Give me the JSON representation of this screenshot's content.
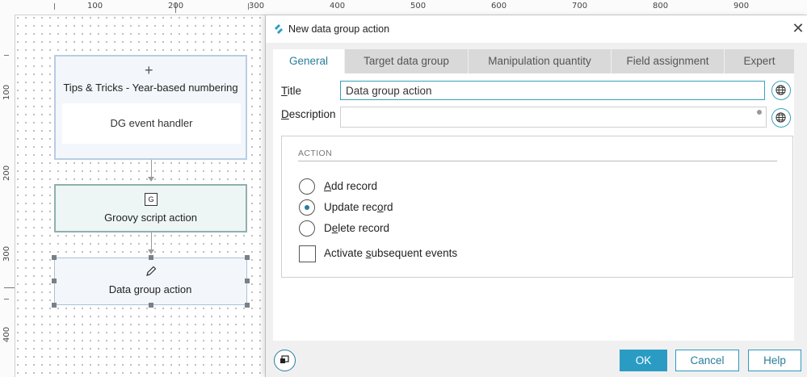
{
  "ruler": {
    "top_labels": [
      "100",
      "200",
      "300",
      "400",
      "500",
      "600",
      "700",
      "800",
      "900"
    ],
    "left_labels": [
      "100",
      "200",
      "300",
      "400"
    ]
  },
  "canvas": {
    "nodes": {
      "handler_title": "Tips & Tricks - Year-based numbering",
      "handler_sub": "DG event handler",
      "script_title": "Groovy script action",
      "script_icon_text": "G",
      "dg_title": "Data group action"
    }
  },
  "dialog": {
    "title": "New data group action",
    "tabs": [
      "General",
      "Target data group",
      "Manipulation quantity",
      "Field assignment",
      "Expert"
    ],
    "active_tab": "General",
    "fields": {
      "title_label_first": "T",
      "title_label_rest": "itle",
      "title_value": "Data group action",
      "description_label_first": "D",
      "description_label_rest": "escription",
      "description_value": ""
    },
    "action": {
      "heading": "ACTION",
      "options": [
        {
          "pre": "",
          "ul": "A",
          "post": "dd record",
          "selected": false
        },
        {
          "pre": "Update rec",
          "ul": "o",
          "post": "rd",
          "selected": true
        },
        {
          "pre": "D",
          "ul": "e",
          "post": "lete record",
          "selected": false
        }
      ],
      "checkbox": {
        "pre": "Activate ",
        "ul": "s",
        "post": "ubsequent events",
        "checked": false
      }
    },
    "buttons": {
      "ok": "OK",
      "cancel": "Cancel",
      "help": "Help"
    }
  },
  "colors": {
    "accent": "#2a9cc4",
    "accent_dark": "#2a7d9b"
  }
}
